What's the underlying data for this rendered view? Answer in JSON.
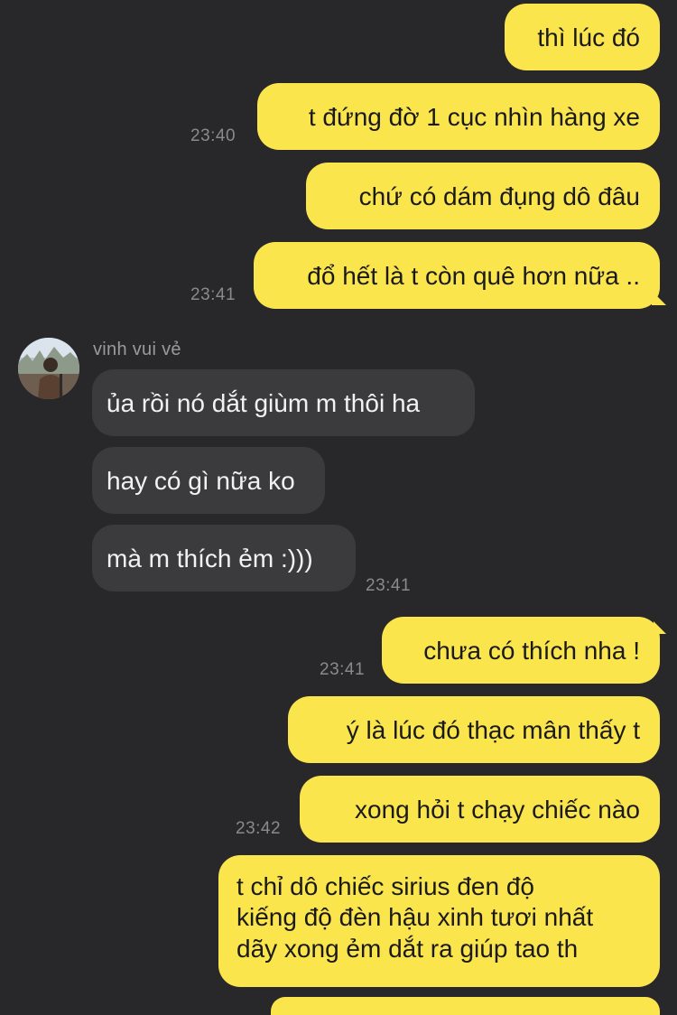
{
  "contact": {
    "name": "vinh vui vẻ"
  },
  "colors": {
    "background": "#28282a",
    "outgoing_bubble": "#fbe54d",
    "incoming_bubble": "#3b3b3d",
    "timestamp": "#8a8a8d"
  },
  "messages": {
    "m1": "thì lúc đó",
    "m2": "t đứng đờ 1 cục nhìn hàng xe",
    "m3": "chứ có dám đụng dô đâu",
    "m4": "đổ hết là t còn quê hơn nữa ..",
    "m5": "ủa rồi nó dắt giùm m thôi ha",
    "m6": "hay có gì nữa ko",
    "m7": "mà m thích ẻm :)))",
    "m8": "chưa có thích nha !",
    "m9": "ý là lúc đó thạc mân thấy t",
    "m10": "xong hỏi t chạy chiếc nào",
    "m11_line1": "t chỉ dô chiếc sirius đen độ",
    "m11_line2": "kiếng độ đèn hậu xinh tươi nhất",
    "m11_line3": "dãy xong ẻm dắt ra giúp tao th"
  },
  "timestamps": {
    "t1": "23:40",
    "t2": "23:41",
    "t3": "23:41",
    "t4": "23:41",
    "t5": "23:42"
  }
}
